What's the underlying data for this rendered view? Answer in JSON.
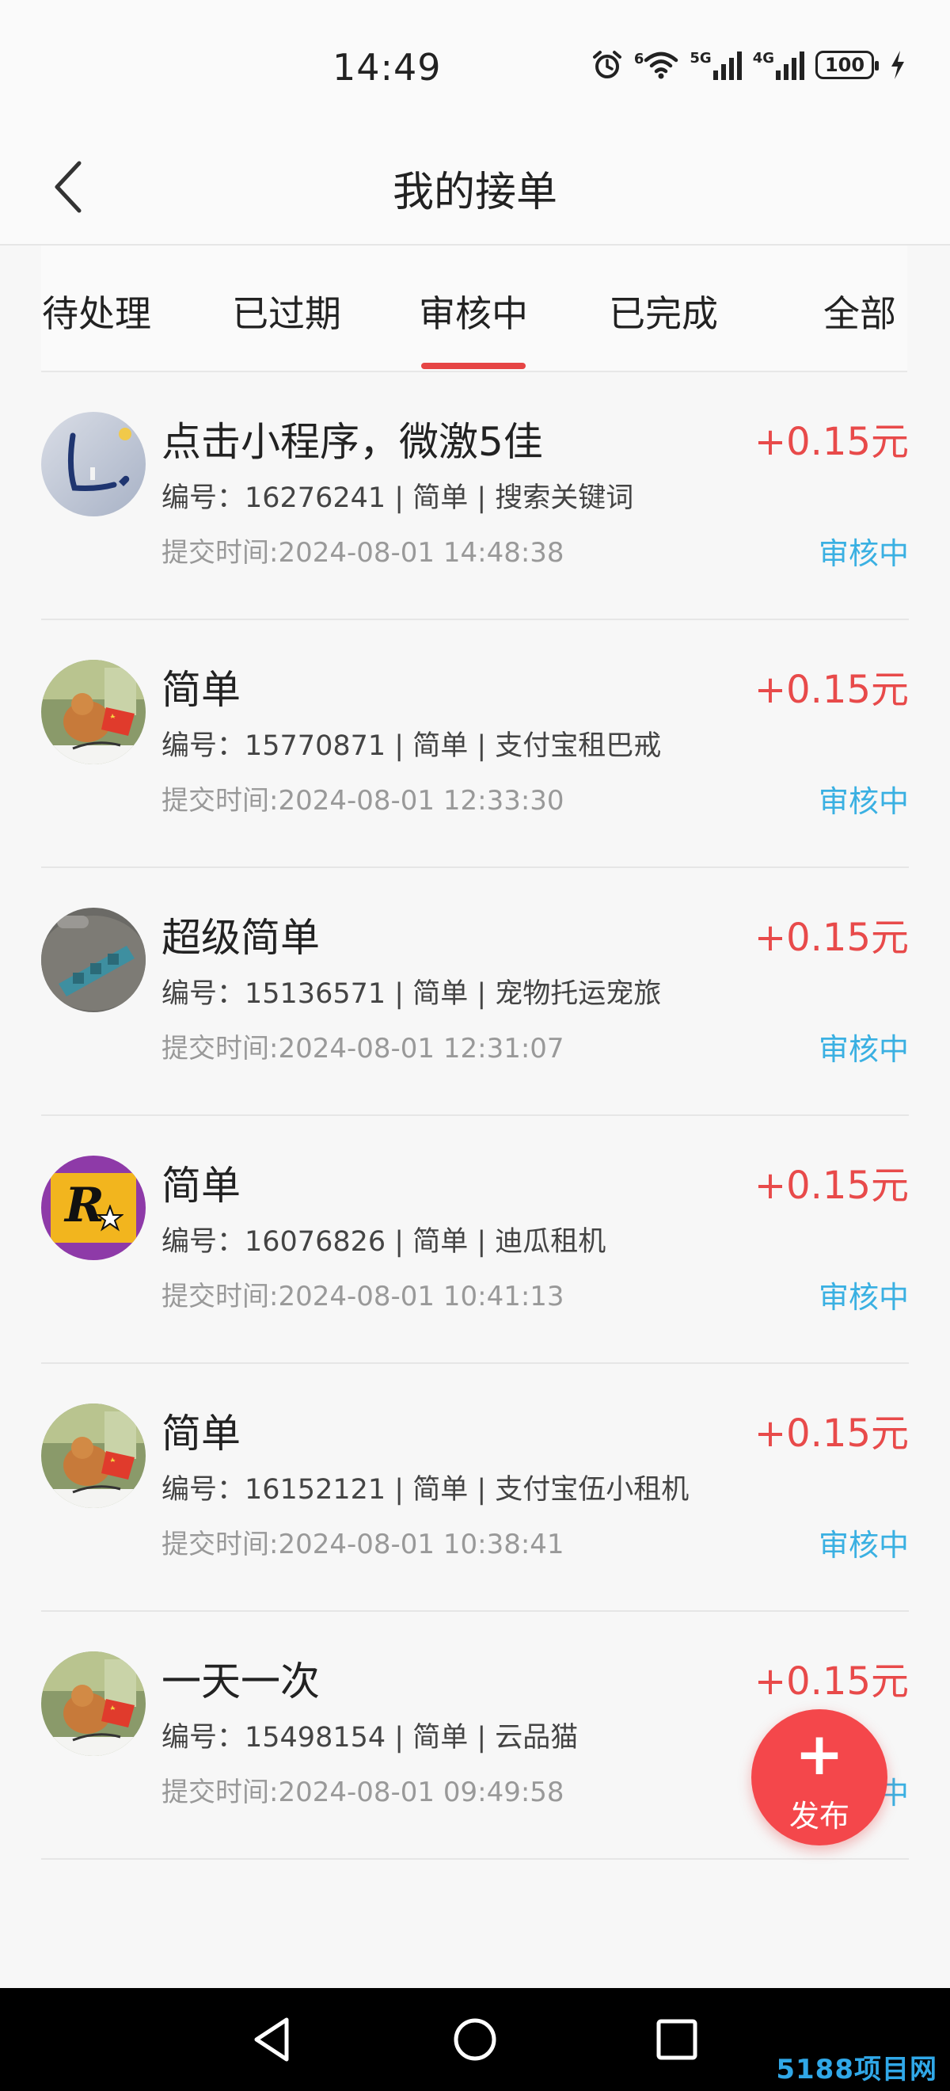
{
  "status_bar": {
    "time": "14:49",
    "wifi_badge": "6",
    "signal_1_label": "5G",
    "signal_2_label": "4G",
    "battery": "100"
  },
  "header": {
    "title": "我的接单"
  },
  "tabs": [
    {
      "label": "待处理",
      "active": false
    },
    {
      "label": "已过期",
      "active": false
    },
    {
      "label": "审核中",
      "active": true
    },
    {
      "label": "已完成",
      "active": false
    },
    {
      "label": "全部",
      "active": false
    }
  ],
  "colors": {
    "accent_red": "#e84a4a",
    "status_blue": "#3ab0e2",
    "fab_red": "#f4474b"
  },
  "orders": [
    {
      "title": "点击小程序，微激5佳",
      "reward": "+0.15元",
      "meta": "编号：16276241 | 简单 | 搜索关键词",
      "time": "提交时间:2024-08-01 14:48:38",
      "status": "审核中",
      "avatar": "letter-l-avatar"
    },
    {
      "title": "简单",
      "reward": "+0.15元",
      "meta": "编号：15770871 | 简单 | 支付宝租巴戒",
      "time": "提交时间:2024-08-01 12:33:30",
      "status": "审核中",
      "avatar": "cat-flag-avatar"
    },
    {
      "title": "超级简单",
      "reward": "+0.15元",
      "meta": "编号：15136571 | 简单 | 宠物托运宠旅",
      "time": "提交时间:2024-08-01 12:31:07",
      "status": "审核中",
      "avatar": "gadget-avatar"
    },
    {
      "title": "简单",
      "reward": "+0.15元",
      "meta": "编号：16076826 | 简单 | 迪瓜租机",
      "time": "提交时间:2024-08-01 10:41:13",
      "status": "审核中",
      "avatar": "r-star-avatar",
      "avatar_text": "R"
    },
    {
      "title": "简单",
      "reward": "+0.15元",
      "meta": "编号：16152121 | 简单 | 支付宝伍小租机",
      "time": "提交时间:2024-08-01 10:38:41",
      "status": "审核中",
      "avatar": "cat-flag-avatar"
    },
    {
      "title": "一天一次",
      "reward": "+0.15元",
      "meta": "编号：15498154 | 简单 | 云品猫",
      "time": "提交时间:2024-08-01 09:49:58",
      "status": "审核中",
      "avatar": "cat-flag-avatar"
    }
  ],
  "fab": {
    "icon": "plus-icon",
    "label": "发布"
  },
  "system_nav": {
    "buttons": [
      "back-triangle-icon",
      "home-circle-icon",
      "recents-square-icon"
    ]
  },
  "watermark": "5188项目网"
}
